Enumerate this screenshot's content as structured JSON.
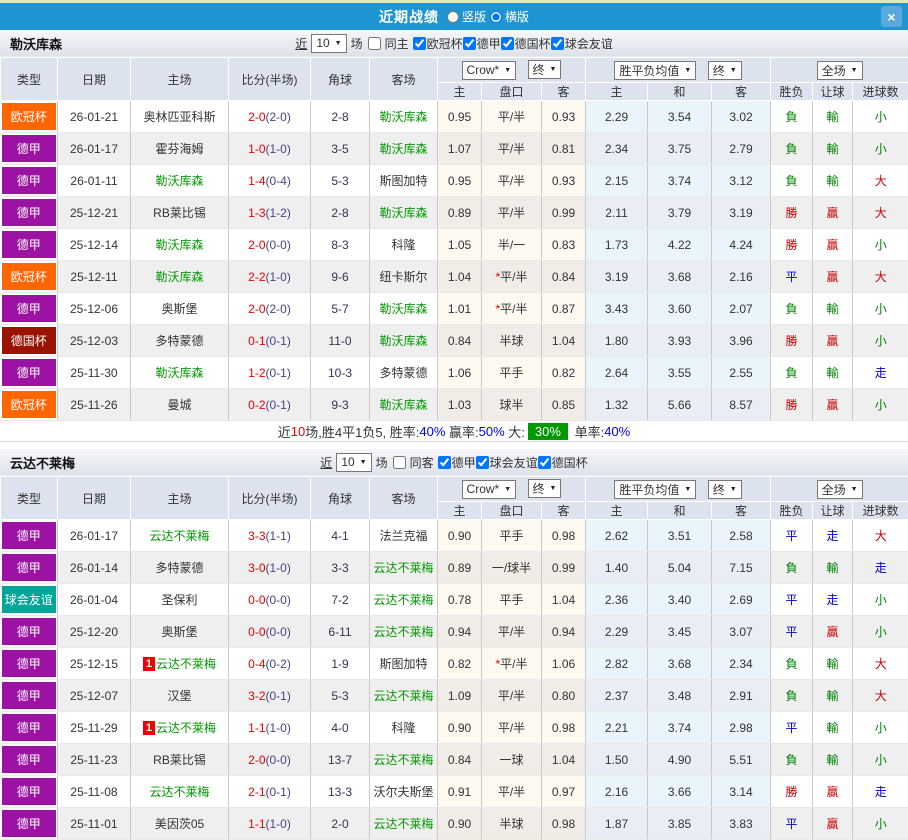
{
  "header": {
    "title": "近期战绩",
    "vertical_label": "竖版",
    "horizontal_label": "横版",
    "close_label": "×"
  },
  "columns": {
    "type": "类型",
    "date": "日期",
    "home": "主场",
    "score": "比分(半场)",
    "corner": "角球",
    "away": "客场",
    "host": "主",
    "handicap": "盘口",
    "guest": "客",
    "host_mean": "主",
    "draw_mean": "和",
    "guest_mean": "客",
    "wdl": "胜负",
    "hcp_result": "让球",
    "goals": "进球数"
  },
  "dropdowns": {
    "company": "Crow*",
    "final": "终",
    "mean": "胜平负均值",
    "full": "全场",
    "caret": "▼"
  },
  "filter_labels": {
    "near": "近",
    "games": "场"
  },
  "type_colors": {
    "欧冠杯": "#ff6600",
    "德甲": "#9c13a4",
    "德国杯": "#991300",
    "球会友谊": "#00a598"
  },
  "result_colors": {
    "勝": "#cc0000",
    "贏": "#cc0000",
    "大": "#cc0000",
    "負": "#008000",
    "輸": "#008000",
    "小": "#008000",
    "平": "#0000cc",
    "走": "#0000cc"
  },
  "text_colors": {
    "score": "#ee0000",
    "half": "#444488",
    "corner": "#333355",
    "focus_team": "#009900",
    "normal_team": "#333333",
    "star": "#ee0000"
  },
  "sections": [
    {
      "team": "勒沃库森",
      "filters": {
        "count": "10",
        "same_label": "同主",
        "same_checked": false,
        "leagues": [
          {
            "label": "欧冠杯",
            "checked": true
          },
          {
            "label": "德甲",
            "checked": true
          },
          {
            "label": "德国杯",
            "checked": true
          },
          {
            "label": "球会友谊",
            "checked": true
          }
        ]
      },
      "rows": [
        {
          "league": "欧冠杯",
          "date": "26-01-21",
          "home": "奥林匹亚科斯",
          "home_focus": false,
          "home_mark": "",
          "score": "2-0",
          "half": "(2-0)",
          "corner": "2-8",
          "away": "勒沃库森",
          "away_focus": true,
          "odds": [
            "0.95",
            "平/半",
            "0.93"
          ],
          "mean": [
            "2.29",
            "3.54",
            "3.02"
          ],
          "results": [
            "負",
            "輸",
            "小"
          ]
        },
        {
          "league": "德甲",
          "date": "26-01-17",
          "home": "霍芬海姆",
          "home_focus": false,
          "home_mark": "",
          "score": "1-0",
          "half": "(1-0)",
          "corner": "3-5",
          "away": "勒沃库森",
          "away_focus": true,
          "odds": [
            "1.07",
            "平/半",
            "0.81"
          ],
          "mean": [
            "2.34",
            "3.75",
            "2.79"
          ],
          "results": [
            "負",
            "輸",
            "小"
          ]
        },
        {
          "league": "德甲",
          "date": "26-01-11",
          "home": "勒沃库森",
          "home_focus": true,
          "home_mark": "",
          "score": "1-4",
          "half": "(0-4)",
          "corner": "5-3",
          "away": "斯图加特",
          "away_focus": false,
          "odds": [
            "0.95",
            "平/半",
            "0.93"
          ],
          "mean": [
            "2.15",
            "3.74",
            "3.12"
          ],
          "results": [
            "負",
            "輸",
            "大"
          ]
        },
        {
          "league": "德甲",
          "date": "25-12-21",
          "home": "RB莱比锡",
          "home_focus": false,
          "home_mark": "",
          "score": "1-3",
          "half": "(1-2)",
          "corner": "2-8",
          "away": "勒沃库森",
          "away_focus": true,
          "odds": [
            "0.89",
            "平/半",
            "0.99"
          ],
          "mean": [
            "2.11",
            "3.79",
            "3.19"
          ],
          "results": [
            "勝",
            "贏",
            "大"
          ]
        },
        {
          "league": "德甲",
          "date": "25-12-14",
          "home": "勒沃库森",
          "home_focus": true,
          "home_mark": "",
          "score": "2-0",
          "half": "(0-0)",
          "corner": "8-3",
          "away": "科隆",
          "away_focus": false,
          "odds": [
            "1.05",
            "半/一",
            "0.83"
          ],
          "mean": [
            "1.73",
            "4.22",
            "4.24"
          ],
          "results": [
            "勝",
            "贏",
            "小"
          ]
        },
        {
          "league": "欧冠杯",
          "date": "25-12-11",
          "home": "勒沃库森",
          "home_focus": true,
          "home_mark": "",
          "score": "2-2",
          "half": "(1-0)",
          "corner": "9-6",
          "away": "纽卡斯尔",
          "away_focus": false,
          "odds": [
            "1.04",
            "*平/半",
            "0.84"
          ],
          "mean": [
            "3.19",
            "3.68",
            "2.16"
          ],
          "results": [
            "平",
            "贏",
            "大"
          ]
        },
        {
          "league": "德甲",
          "date": "25-12-06",
          "home": "奥斯堡",
          "home_focus": false,
          "home_mark": "",
          "score": "2-0",
          "half": "(2-0)",
          "corner": "5-7",
          "away": "勒沃库森",
          "away_focus": true,
          "odds": [
            "1.01",
            "*平/半",
            "0.87"
          ],
          "mean": [
            "3.43",
            "3.60",
            "2.07"
          ],
          "results": [
            "負",
            "輸",
            "小"
          ]
        },
        {
          "league": "德国杯",
          "date": "25-12-03",
          "home": "多特蒙德",
          "home_focus": false,
          "home_mark": "",
          "score": "0-1",
          "half": "(0-1)",
          "corner": "11-0",
          "away": "勒沃库森",
          "away_focus": true,
          "odds": [
            "0.84",
            "半球",
            "1.04"
          ],
          "mean": [
            "1.80",
            "3.93",
            "3.96"
          ],
          "results": [
            "勝",
            "贏",
            "小"
          ]
        },
        {
          "league": "德甲",
          "date": "25-11-30",
          "home": "勒沃库森",
          "home_focus": true,
          "home_mark": "",
          "score": "1-2",
          "half": "(0-1)",
          "corner": "10-3",
          "away": "多特蒙德",
          "away_focus": false,
          "odds": [
            "1.06",
            "平手",
            "0.82"
          ],
          "mean": [
            "2.64",
            "3.55",
            "2.55"
          ],
          "results": [
            "負",
            "輸",
            "走"
          ]
        },
        {
          "league": "欧冠杯",
          "date": "25-11-26",
          "home": "曼城",
          "home_focus": false,
          "home_mark": "",
          "score": "0-2",
          "half": "(0-1)",
          "corner": "9-3",
          "away": "勒沃库森",
          "away_focus": true,
          "odds": [
            "1.03",
            "球半",
            "0.85"
          ],
          "mean": [
            "1.32",
            "5.66",
            "8.57"
          ],
          "results": [
            "勝",
            "贏",
            "小"
          ]
        }
      ],
      "summary": [
        {
          "t": "近",
          "c": "#333333"
        },
        {
          "t": "10",
          "c": "#ee0000"
        },
        {
          "t": "场,胜4平1负5, 胜率:",
          "c": "#333333"
        },
        {
          "t": "40%",
          "c": "#0000ee"
        },
        {
          "t": " 赢率:",
          "c": "#333333"
        },
        {
          "t": "50%",
          "c": "#0000ee"
        },
        {
          "t": " 大:",
          "c": "#333333"
        },
        {
          "t": "30%",
          "c": "badge"
        },
        {
          "t": " 单率:",
          "c": "#333333"
        },
        {
          "t": "40%",
          "c": "#0000ee"
        }
      ]
    },
    {
      "team": "云达不莱梅",
      "filters": {
        "count": "10",
        "same_label": "同客",
        "same_checked": false,
        "leagues": [
          {
            "label": "德甲",
            "checked": true
          },
          {
            "label": "球会友谊",
            "checked": true
          },
          {
            "label": "德国杯",
            "checked": true
          }
        ]
      },
      "rows": [
        {
          "league": "德甲",
          "date": "26-01-17",
          "home": "云达不莱梅",
          "home_focus": true,
          "home_mark": "",
          "score": "3-3",
          "half": "(1-1)",
          "corner": "4-1",
          "away": "法兰克福",
          "away_focus": false,
          "odds": [
            "0.90",
            "平手",
            "0.98"
          ],
          "mean": [
            "2.62",
            "3.51",
            "2.58"
          ],
          "results": [
            "平",
            "走",
            "大"
          ]
        },
        {
          "league": "德甲",
          "date": "26-01-14",
          "home": "多特蒙德",
          "home_focus": false,
          "home_mark": "",
          "score": "3-0",
          "half": "(1-0)",
          "corner": "3-3",
          "away": "云达不莱梅",
          "away_focus": true,
          "odds": [
            "0.89",
            "一/球半",
            "0.99"
          ],
          "mean": [
            "1.40",
            "5.04",
            "7.15"
          ],
          "results": [
            "負",
            "輸",
            "走"
          ]
        },
        {
          "league": "球会友谊",
          "date": "26-01-04",
          "home": "圣保利",
          "home_focus": false,
          "home_mark": "",
          "score": "0-0",
          "half": "(0-0)",
          "corner": "7-2",
          "away": "云达不莱梅",
          "away_focus": true,
          "odds": [
            "0.78",
            "平手",
            "1.04"
          ],
          "mean": [
            "2.36",
            "3.40",
            "2.69"
          ],
          "results": [
            "平",
            "走",
            "小"
          ]
        },
        {
          "league": "德甲",
          "date": "25-12-20",
          "home": "奥斯堡",
          "home_focus": false,
          "home_mark": "",
          "score": "0-0",
          "half": "(0-0)",
          "corner": "6-11",
          "away": "云达不莱梅",
          "away_focus": true,
          "odds": [
            "0.94",
            "平/半",
            "0.94"
          ],
          "mean": [
            "2.29",
            "3.45",
            "3.07"
          ],
          "results": [
            "平",
            "贏",
            "小"
          ]
        },
        {
          "league": "德甲",
          "date": "25-12-15",
          "home": "云达不莱梅",
          "home_focus": true,
          "home_mark": "1",
          "score": "0-4",
          "half": "(0-2)",
          "corner": "1-9",
          "away": "斯图加特",
          "away_focus": false,
          "odds": [
            "0.82",
            "*平/半",
            "1.06"
          ],
          "mean": [
            "2.82",
            "3.68",
            "2.34"
          ],
          "results": [
            "負",
            "輸",
            "大"
          ]
        },
        {
          "league": "德甲",
          "date": "25-12-07",
          "home": "汉堡",
          "home_focus": false,
          "home_mark": "",
          "score": "3-2",
          "half": "(0-1)",
          "corner": "5-3",
          "away": "云达不莱梅",
          "away_focus": true,
          "odds": [
            "1.09",
            "平/半",
            "0.80"
          ],
          "mean": [
            "2.37",
            "3.48",
            "2.91"
          ],
          "results": [
            "負",
            "輸",
            "大"
          ]
        },
        {
          "league": "德甲",
          "date": "25-11-29",
          "home": "云达不莱梅",
          "home_focus": true,
          "home_mark": "1",
          "score": "1-1",
          "half": "(1-0)",
          "corner": "4-0",
          "away": "科隆",
          "away_focus": false,
          "odds": [
            "0.90",
            "平/半",
            "0.98"
          ],
          "mean": [
            "2.21",
            "3.74",
            "2.98"
          ],
          "results": [
            "平",
            "輸",
            "小"
          ]
        },
        {
          "league": "德甲",
          "date": "25-11-23",
          "home": "RB莱比锡",
          "home_focus": false,
          "home_mark": "",
          "score": "2-0",
          "half": "(0-0)",
          "corner": "13-7",
          "away": "云达不莱梅",
          "away_focus": true,
          "odds": [
            "0.84",
            "一球",
            "1.04"
          ],
          "mean": [
            "1.50",
            "4.90",
            "5.51"
          ],
          "results": [
            "負",
            "輸",
            "小"
          ]
        },
        {
          "league": "德甲",
          "date": "25-11-08",
          "home": "云达不莱梅",
          "home_focus": true,
          "home_mark": "",
          "score": "2-1",
          "half": "(0-1)",
          "corner": "13-3",
          "away": "沃尔夫斯堡",
          "away_focus": false,
          "odds": [
            "0.91",
            "平/半",
            "0.97"
          ],
          "mean": [
            "2.16",
            "3.66",
            "3.14"
          ],
          "results": [
            "勝",
            "贏",
            "走"
          ]
        },
        {
          "league": "德甲",
          "date": "25-11-01",
          "home": "美因茨05",
          "home_focus": false,
          "home_mark": "",
          "score": "1-1",
          "half": "(1-0)",
          "corner": "2-0",
          "away": "云达不莱梅",
          "away_focus": true,
          "odds": [
            "0.90",
            "半球",
            "0.98"
          ],
          "mean": [
            "1.87",
            "3.85",
            "3.83"
          ],
          "results": [
            "平",
            "贏",
            "小"
          ]
        }
      ],
      "summary": null
    }
  ]
}
